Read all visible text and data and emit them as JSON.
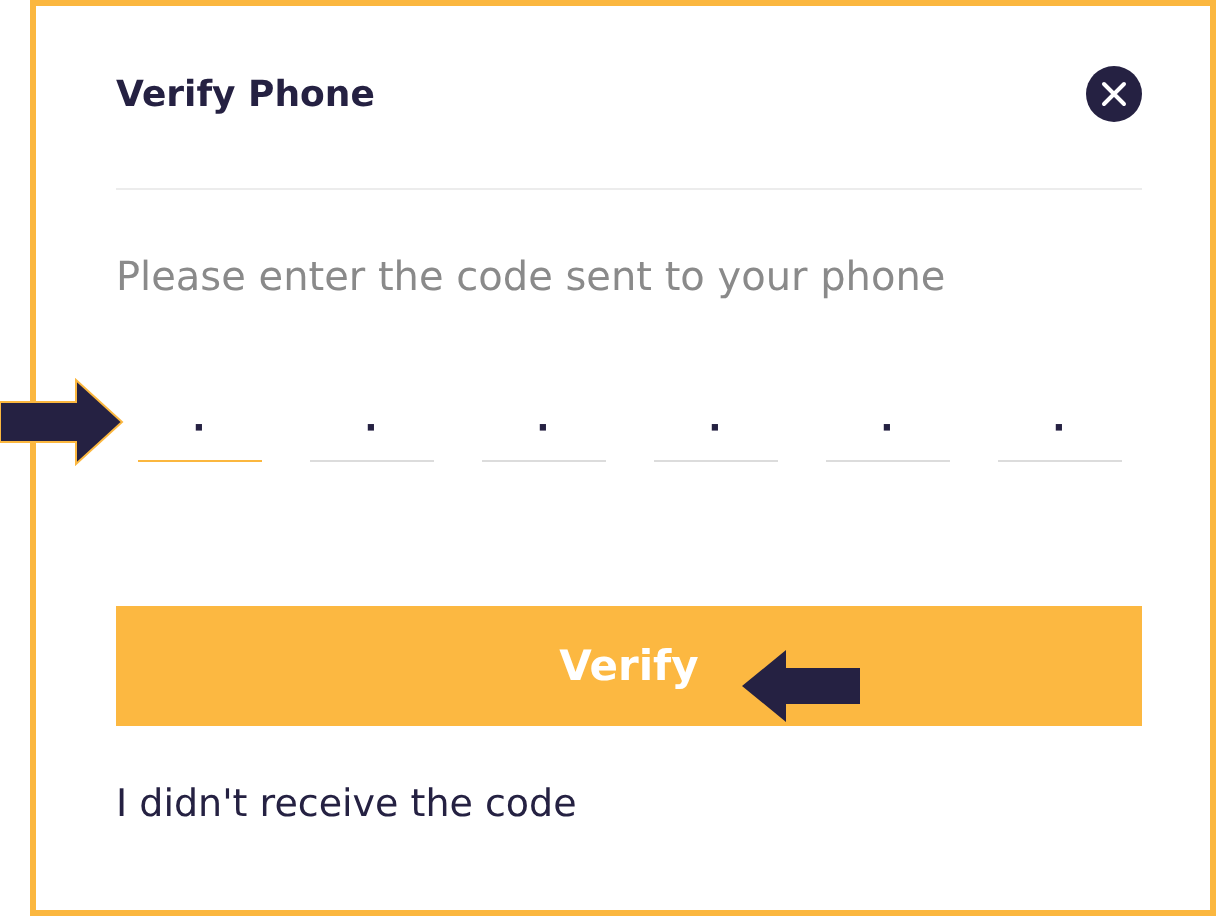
{
  "dialog": {
    "title": "Verify Phone"
  },
  "prompt": "Please enter the code sent to your phone",
  "code_fields": [
    {
      "placeholder": "·",
      "focused": true
    },
    {
      "placeholder": "·",
      "focused": false
    },
    {
      "placeholder": "·",
      "focused": false
    },
    {
      "placeholder": "·",
      "focused": false
    },
    {
      "placeholder": "·",
      "focused": false
    },
    {
      "placeholder": "·",
      "focused": false
    }
  ],
  "verify_button": "Verify",
  "resend_link": "I didn't receive the code"
}
